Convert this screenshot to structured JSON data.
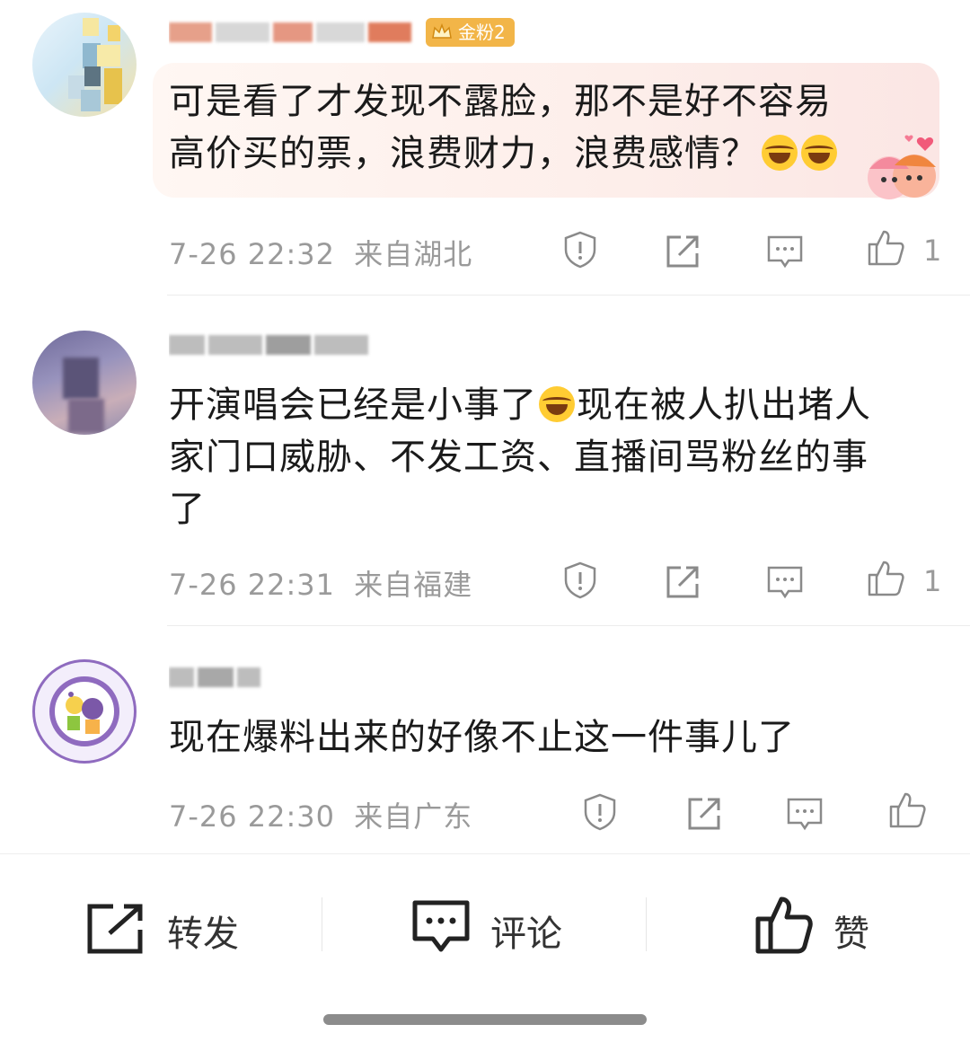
{
  "comments": [
    {
      "username_masked": "用户名",
      "badge": "金粉2",
      "text_line1": "可是看了才发现不露脸，那不是好不容易",
      "text_line2": "高价买的票，浪费财力，浪费感情？",
      "time": "7-26 22:32",
      "location": "来自湖北",
      "likes": "1"
    },
    {
      "username_masked": "用户名",
      "text_line1": "开演唱会已经是小事了",
      "text_line1b": "现在被人扒出堵人",
      "text_line2": "家门口威胁、不发工资、直播间骂粉丝的事",
      "text_line3": "了",
      "time": "7-26 22:31",
      "location": "来自福建",
      "likes": "1"
    },
    {
      "username_masked": "用户名",
      "text_line1": "现在爆料出来的好像不止这一件事儿了",
      "time": "7-26 22:30",
      "location": "来自广东",
      "likes": ""
    }
  ],
  "icons": {
    "report": "report-icon",
    "repost": "repost-icon",
    "reply": "comment-icon",
    "like": "like-icon",
    "emoji": "laugh-cry-emoji"
  },
  "bottom_bar": {
    "repost_label": "转发",
    "comment_label": "评论",
    "like_label": "赞"
  },
  "colors": {
    "badge": "#f2b548",
    "meta_text": "#9a9a9a",
    "bubble": "#fdeeea"
  }
}
